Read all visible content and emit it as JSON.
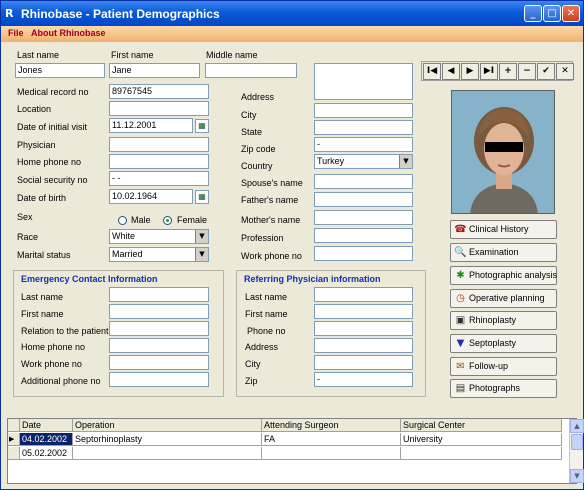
{
  "window": {
    "app_icon": "R",
    "title": "Rhinobase  -  Patient Demographics",
    "minimize_glyph": "_",
    "maximize_glyph": "□",
    "close_glyph": "✕"
  },
  "menu": {
    "items": [
      "File",
      "About Rhinobase"
    ]
  },
  "patient": {
    "last_name_label": "Last name",
    "last_name": "Jones",
    "first_name_label": "First name",
    "first_name": "Jane",
    "middle_name_label": "Middle name",
    "middle_name": "",
    "mrn_label": "Medical record no",
    "mrn": "89767545",
    "location_label": "Location",
    "location": "",
    "initial_visit_label": "Date of initial visit",
    "initial_visit": "11.12.2001",
    "physician_label": "Physician",
    "physician": "",
    "home_phone_label": "Home phone no",
    "home_phone": "",
    "ssn_label": "Social security no",
    "ssn": "  -  -",
    "dob_label": "Date of birth",
    "dob": "10.02.1964",
    "sex_label": "Sex",
    "sex_options": [
      "Male",
      "Female"
    ],
    "sex_selected": "Female",
    "race_label": "Race",
    "race": "White",
    "marital_label": "Marital status",
    "marital": "Married"
  },
  "address": {
    "address_label": "Address",
    "address": "",
    "city_label": "City",
    "city": "",
    "state_label": "State",
    "state": "",
    "zip_label": "Zip code",
    "zip": "  -",
    "country_label": "Country",
    "country": "Turkey",
    "spouse_label": "Spouse's name",
    "spouse": "",
    "father_label": "Father's name",
    "father": "",
    "mother_label": "Mother's name",
    "mother": "",
    "profession_label": "Profession",
    "profession": "",
    "work_phone_label": "Work phone no",
    "work_phone": ""
  },
  "nav": {
    "first": "I◀",
    "prev": "◀",
    "next": "▶",
    "last": "▶I",
    "add": "+",
    "delete": "−",
    "post": "✔",
    "cancel": "✕"
  },
  "side_buttons": [
    {
      "label": "Clinical History",
      "icon": "clinical-history-icon",
      "glyph": "☎"
    },
    {
      "label": "Examination",
      "icon": "examination-icon",
      "glyph": "🔍"
    },
    {
      "label": "Photographic analysis",
      "icon": "photographic-analysis-icon",
      "glyph": "✱"
    },
    {
      "label": "Operative planning",
      "icon": "operative-planning-icon",
      "glyph": "◷"
    },
    {
      "label": "Rhinoplasty",
      "icon": "rhinoplasty-icon",
      "glyph": "▣"
    },
    {
      "label": "Septoplasty",
      "icon": "septoplasty-icon",
      "glyph": "▼"
    },
    {
      "label": "Follow-up",
      "icon": "follow-up-icon",
      "glyph": "✉"
    },
    {
      "label": "Photographs",
      "icon": "photographs-icon",
      "glyph": "▤"
    }
  ],
  "emergency": {
    "title": "Emergency Contact Information",
    "last_name_label": "Last name",
    "last_name": "",
    "first_name_label": "First name",
    "first_name": "",
    "relation_label": "Relation to the patient",
    "relation": "",
    "home_phone_label": "Home phone no",
    "home_phone": "",
    "work_phone_label": "Work phone no",
    "work_phone": "",
    "additional_phone_label": "Additional phone no",
    "additional_phone": ""
  },
  "referring": {
    "title": "Referring Physician information",
    "last_name_label": "Last name",
    "last_name": "",
    "first_name_label": "First name",
    "first_name": "",
    "phone_label": "Phone no",
    "phone": "",
    "address_label": "Address",
    "address": "",
    "city_label": "City",
    "city": "",
    "zip_label": "Zip",
    "zip": "  -"
  },
  "grid": {
    "columns": [
      "Date",
      "Operation",
      "Attending Surgeon",
      "Surgical Center"
    ],
    "rows": [
      [
        "04.02.2002",
        "Septorhinoplasty",
        "FA",
        "University"
      ],
      [
        "05.02.2002",
        "",
        "",
        ""
      ]
    ],
    "current_row_marker": "▶"
  },
  "colors": {
    "title_bar": "#0a5bd6",
    "menu_bar": "#f2b070",
    "group_title": "#1030b0",
    "selected_cell": "#0a246a"
  }
}
